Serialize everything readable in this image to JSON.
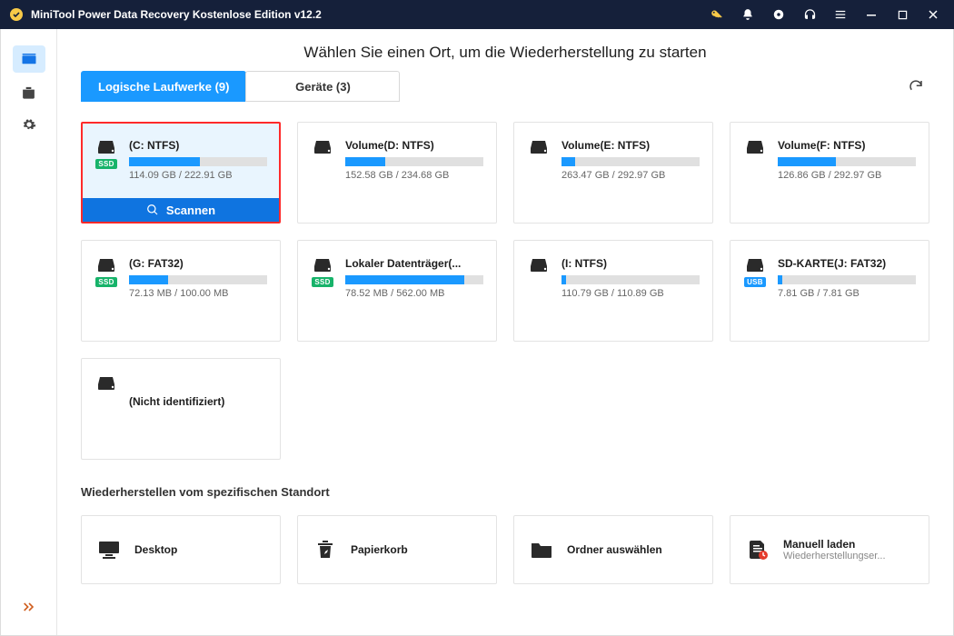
{
  "titlebar": {
    "title": "MiniTool Power Data Recovery Kostenlose Edition v12.2"
  },
  "page": {
    "heading": "Wählen Sie einen Ort, um die Wiederherstellung zu starten"
  },
  "tabs": {
    "logical": "Logische Laufwerke (9)",
    "devices": "Geräte (3)"
  },
  "scan_button_label": "Scannen",
  "drives": [
    {
      "name": "(C: NTFS)",
      "size": "114.09 GB / 222.91 GB",
      "fill": 51,
      "badge": "SSD",
      "selected": true
    },
    {
      "name": "Volume(D: NTFS)",
      "size": "152.58 GB / 234.68 GB",
      "fill": 29,
      "badge": null,
      "selected": false
    },
    {
      "name": "Volume(E: NTFS)",
      "size": "263.47 GB / 292.97 GB",
      "fill": 10,
      "badge": null,
      "selected": false
    },
    {
      "name": "Volume(F: NTFS)",
      "size": "126.86 GB / 292.97 GB",
      "fill": 42,
      "badge": null,
      "selected": false
    },
    {
      "name": "(G: FAT32)",
      "size": "72.13 MB / 100.00 MB",
      "fill": 28,
      "badge": "SSD",
      "selected": false
    },
    {
      "name": "Lokaler Datenträger(...",
      "size": "78.52 MB / 562.00 MB",
      "fill": 86,
      "badge": "SSD",
      "selected": false
    },
    {
      "name": "(I: NTFS)",
      "size": "110.79 GB / 110.89 GB",
      "fill": 3,
      "badge": null,
      "selected": false
    },
    {
      "name": "SD-KARTE(J: FAT32)",
      "size": "7.81 GB / 7.81 GB",
      "fill": 3,
      "badge": "USB",
      "selected": false
    },
    {
      "name": "(Nicht identifiziert)",
      "size": "",
      "fill": 0,
      "badge": null,
      "selected": false,
      "nobar": true
    }
  ],
  "recover": {
    "section_title": "Wiederherstellen vom spezifischen Standort",
    "locations": {
      "desktop": {
        "title": "Desktop",
        "sub": ""
      },
      "recycle_bin": {
        "title": "Papierkorb",
        "sub": ""
      },
      "select_folder": {
        "title": "Ordner auswählen",
        "sub": ""
      },
      "manual_load": {
        "title": "Manuell laden",
        "sub": "Wiederherstellungser..."
      }
    }
  }
}
